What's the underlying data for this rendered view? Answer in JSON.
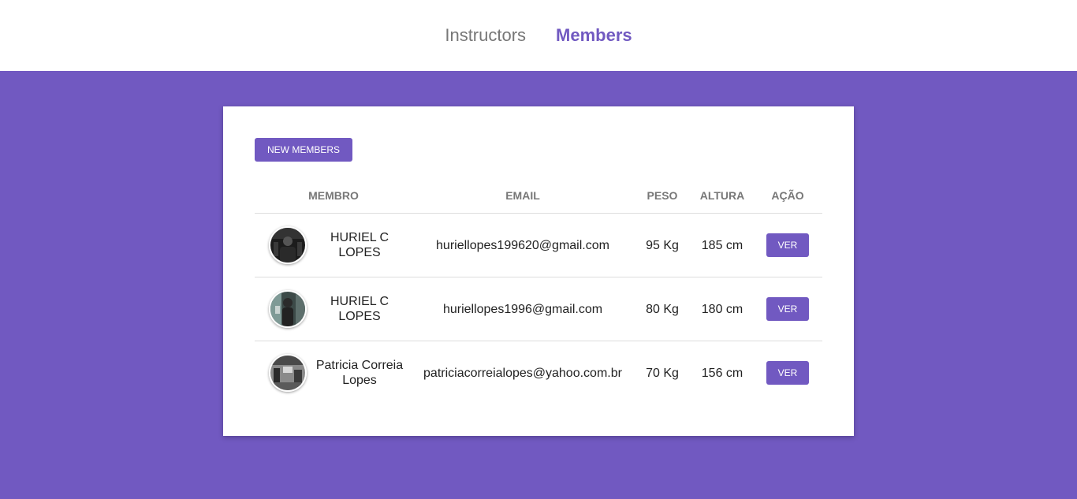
{
  "nav": {
    "items": [
      {
        "label": "Instructors",
        "active": false
      },
      {
        "label": "Members",
        "active": true
      }
    ]
  },
  "members_page": {
    "new_button_label": "NEW MEMBERS",
    "columns": [
      "MEMBRO",
      "EMAIL",
      "PESO",
      "ALTURA",
      "AÇÃO"
    ],
    "rows": [
      {
        "name": "HURIEL C LOPES",
        "email": "huriellopes199620@gmail.com",
        "weight": "95 Kg",
        "height": "185 cm",
        "action": "VER",
        "avatar": "dark-gym-photo-avatar"
      },
      {
        "name": "HURIEL C LOPES",
        "email": "huriellopes1996@gmail.com",
        "weight": "80 Kg",
        "height": "180 cm",
        "action": "VER",
        "avatar": "gym-woman-photo-avatar"
      },
      {
        "name": "Patricia Correia Lopes",
        "email": "patriciacorreialopes@yahoo.com.br",
        "weight": "70 Kg",
        "height": "156 cm",
        "action": "VER",
        "avatar": "gym-equipment-photo-avatar"
      }
    ]
  },
  "colors": {
    "accent": "#7159c1",
    "header_bg": "#ffffff",
    "muted_text": "#777777"
  }
}
